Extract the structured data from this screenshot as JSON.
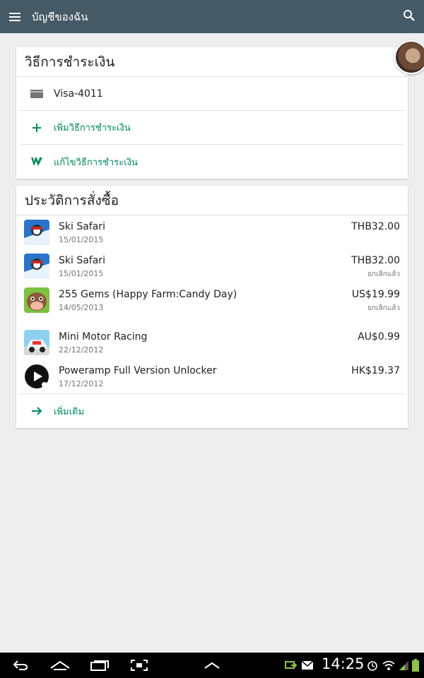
{
  "appbar": {
    "title": "บัญชีของฉัน",
    "menu_icon": "hamburger-menu-icon",
    "search_icon": "search-icon"
  },
  "payment_methods": {
    "title": "วิธีการชำระเงิน",
    "card_label": "Visa-4011",
    "add_label": "เพิ่มวิธีการชำระเงิน",
    "edit_label": "แก้ไขวิธีการชำระเงิน"
  },
  "purchase_history": {
    "title": "ประวัติการสั่งซื้อ",
    "items": [
      {
        "name": "Ski Safari",
        "date": "15/01/2015",
        "price": "THB32.00",
        "status": ""
      },
      {
        "name": "Ski Safari",
        "date": "15/01/2015",
        "price": "THB32.00",
        "status": "ยกเลิกแล้ว"
      },
      {
        "name": "255 Gems (Happy Farm:Candy Day)",
        "date": "14/05/2013",
        "price": "US$19.99",
        "status": "ยกเลิกแล้ว"
      },
      {
        "name": "Mini Motor Racing",
        "date": "22/12/2012",
        "price": "AU$0.99",
        "status": ""
      },
      {
        "name": "Poweramp Full Version Unlocker",
        "date": "17/12/2012",
        "price": "HK$19.37",
        "status": ""
      }
    ],
    "more_label": "เพิ่มเติม"
  },
  "status_bar": {
    "time": "14:25"
  },
  "colors": {
    "appbar": "#455a64",
    "link": "#01875f",
    "background": "#eeeeee"
  }
}
